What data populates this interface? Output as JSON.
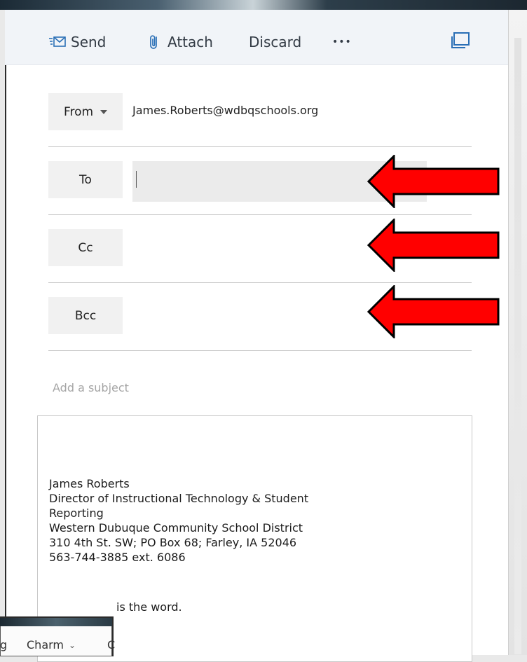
{
  "toolbar": {
    "send_label": "Send",
    "attach_label": "Attach",
    "discard_label": "Discard",
    "more_label": "•••"
  },
  "from": {
    "label": "From",
    "address": "James.Roberts@wdbqschools.org"
  },
  "to": {
    "label": "To",
    "value": ""
  },
  "cc": {
    "label": "Cc"
  },
  "bcc": {
    "label": "Bcc"
  },
  "subject": {
    "placeholder": "Add a subject"
  },
  "signature": {
    "lines": [
      "James Roberts",
      "Director of Instructional Technology & Student",
      "Reporting",
      "Western Dubuque Community School District",
      "310 4th St. SW; PO Box 68; Farley, IA  52046",
      "563-744-3885  ext. 6086"
    ],
    "partial_line": "is the word."
  },
  "popup": {
    "left_fragment": "g",
    "item_label": "Charm",
    "right_fragment": "C"
  },
  "colors": {
    "accent": "#2a6fb6",
    "arrow_fill": "#ff0000",
    "arrow_stroke": "#000000"
  }
}
